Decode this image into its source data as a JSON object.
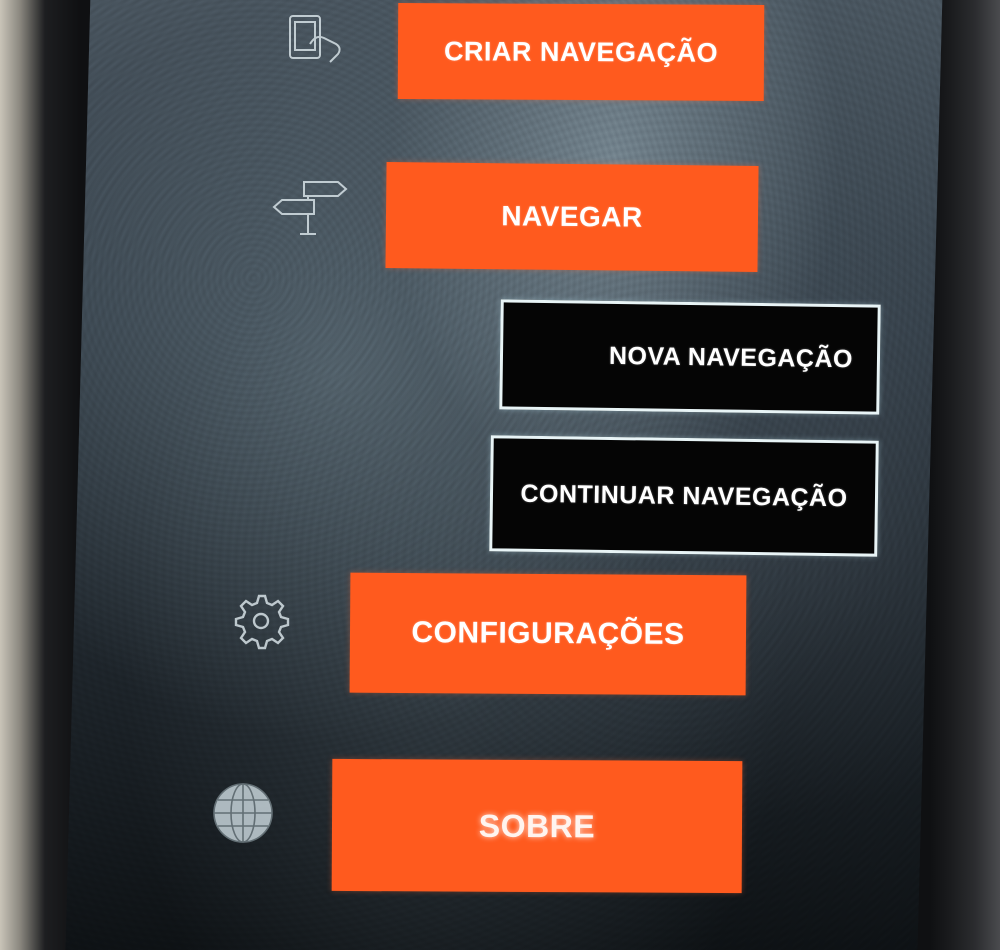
{
  "menu": {
    "create_label": "CRIAR NAVEGAÇÃO",
    "navigate_label": "NAVEGAR",
    "new_navigation_label": "NOVA NAVEGAÇÃO",
    "continue_navigation_label": "CONTINUAR NAVEGAÇÃO",
    "settings_label": "CONFIGURAÇÕES",
    "about_label": "SOBRE"
  },
  "icons": {
    "create": "tablet-touch-icon",
    "navigate": "signpost-icon",
    "settings": "gear-icon",
    "about": "globe-icon"
  },
  "colors": {
    "accent": "#ff5a1e",
    "secondary_bg": "#050505",
    "secondary_border": "#e8f4f6"
  }
}
